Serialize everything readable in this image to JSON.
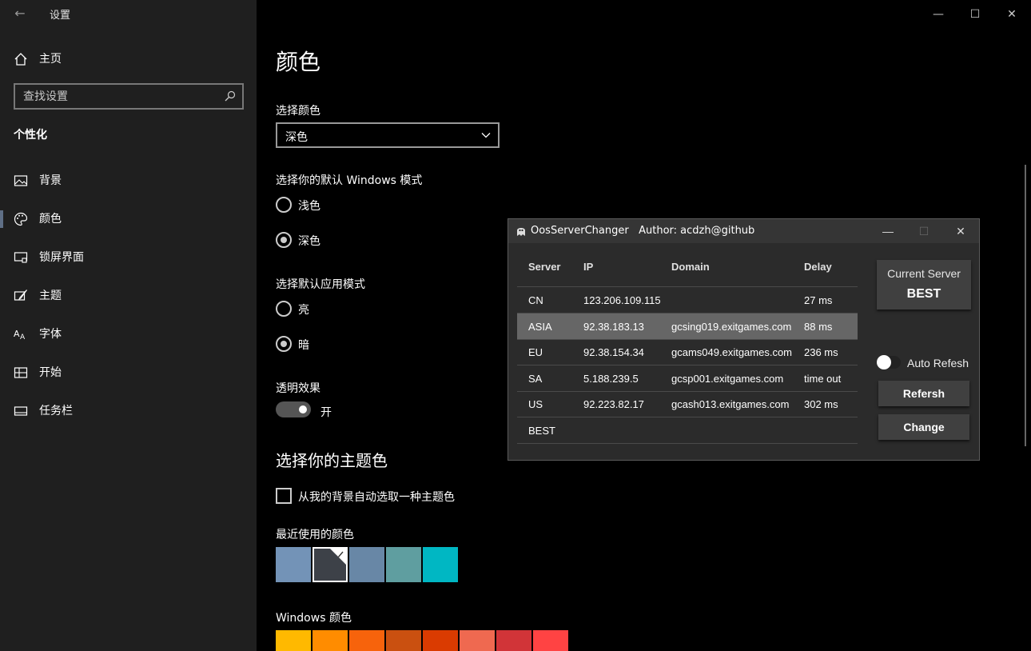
{
  "settings": {
    "title": "设置",
    "home": "主页",
    "search_placeholder": "查找设置",
    "section": "个性化",
    "nav": [
      {
        "label": "背景",
        "icon": "image-icon"
      },
      {
        "label": "颜色",
        "icon": "palette-icon"
      },
      {
        "label": "锁屏界面",
        "icon": "lock-screen-icon"
      },
      {
        "label": "主题",
        "icon": "theme-brush-icon"
      },
      {
        "label": "字体",
        "icon": "font-icon"
      },
      {
        "label": "开始",
        "icon": "start-menu-icon"
      },
      {
        "label": "任务栏",
        "icon": "taskbar-icon"
      }
    ],
    "active_nav": "颜色"
  },
  "colors_page": {
    "title": "颜色",
    "choose_color_label": "选择颜色",
    "choose_color_value": "深色",
    "windows_mode_label": "选择你的默认 Windows 模式",
    "windows_mode_options": [
      "浅色",
      "深色"
    ],
    "windows_mode_selected": "深色",
    "app_mode_label": "选择默认应用模式",
    "app_mode_options": [
      "亮",
      "暗"
    ],
    "app_mode_selected": "暗",
    "transparency_label": "透明效果",
    "transparency_state": "开",
    "accent_heading": "选择你的主题色",
    "auto_accent_label": "从我的背景自动选取一种主题色",
    "recent_label": "最近使用的颜色",
    "recent_colors": [
      "#7393b7",
      "#3d4148",
      "#6887a6",
      "#5f9ea0",
      "#00b7c3"
    ],
    "recent_selected_index": 1,
    "windows_colors_label": "Windows 颜色",
    "windows_colors": [
      "#ffb900",
      "#ff8c00",
      "#f7630c",
      "#ca5010",
      "#da3b01",
      "#ef6950",
      "#d13438",
      "#ff4343"
    ]
  },
  "oos": {
    "app_name": "OosServerChanger",
    "author": "Author: acdzh@github",
    "columns": [
      "Server",
      "IP",
      "Domain",
      "Delay"
    ],
    "rows": [
      {
        "server": "CN",
        "ip": "123.206.109.115",
        "domain": "",
        "delay": "27 ms"
      },
      {
        "server": "ASIA",
        "ip": "92.38.183.13",
        "domain": "gcsing019.exitgames.com",
        "delay": "88 ms"
      },
      {
        "server": "EU",
        "ip": "92.38.154.34",
        "domain": "gcams049.exitgames.com",
        "delay": "236 ms"
      },
      {
        "server": "SA",
        "ip": "5.188.239.5",
        "domain": "gcsp001.exitgames.com",
        "delay": "time out"
      },
      {
        "server": "US",
        "ip": "92.223.82.17",
        "domain": "gcash013.exitgames.com",
        "delay": "302 ms"
      },
      {
        "server": "BEST",
        "ip": "",
        "domain": "",
        "delay": ""
      }
    ],
    "selected_row": 1,
    "current_server_label": "Current Server",
    "current_server_value": "BEST",
    "auto_refresh_label": "Auto Refesh",
    "refresh_button": "Refersh",
    "change_button": "Change"
  }
}
